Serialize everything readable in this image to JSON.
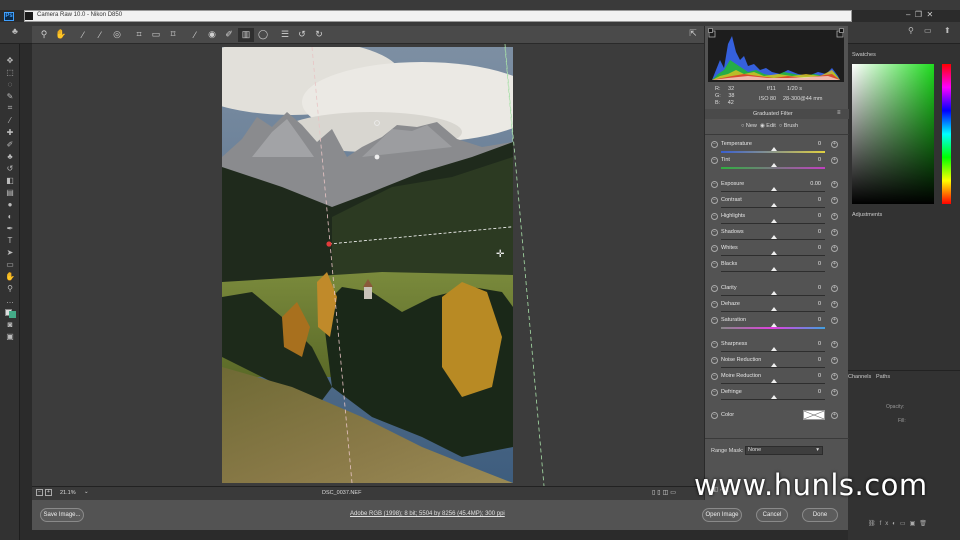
{
  "dialog": {
    "title": "Camera Raw 10.0  -  Nikon D850",
    "filename": "DSC_0037.NEF",
    "zoom": "21.1%",
    "workflow": "Adobe RGB (1998); 8 bit; 5504 by 8256 (45.4MP); 300 ppi"
  },
  "buttons": {
    "save": "Save Image...",
    "open": "Open Image",
    "cancel": "Cancel",
    "done": "Done"
  },
  "readout": {
    "r_label": "R:",
    "r_value": "32",
    "g_label": "G:",
    "g_value": "38",
    "b_label": "B:",
    "b_value": "42",
    "aperture": "f/11",
    "shutter": "1/20 s",
    "iso": "ISO 80",
    "lens": "28-300@44 mm"
  },
  "filter": {
    "title": "Graduated Filter",
    "modes": [
      "New",
      "Edit",
      "Brush"
    ],
    "selected_mode": "Edit"
  },
  "sliders_group1": [
    {
      "label": "Temperature",
      "value": "0"
    },
    {
      "label": "Tint",
      "value": "0"
    }
  ],
  "sliders_group2": [
    {
      "label": "Exposure",
      "value": "0.00"
    },
    {
      "label": "Contrast",
      "value": "0"
    },
    {
      "label": "Highlights",
      "value": "0"
    },
    {
      "label": "Shadows",
      "value": "0"
    },
    {
      "label": "Whites",
      "value": "0"
    },
    {
      "label": "Blacks",
      "value": "0"
    }
  ],
  "sliders_group3": [
    {
      "label": "Clarity",
      "value": "0"
    },
    {
      "label": "Dehaze",
      "value": "0"
    },
    {
      "label": "Saturation",
      "value": "0"
    }
  ],
  "sliders_group4": [
    {
      "label": "Sharpness",
      "value": "0"
    },
    {
      "label": "Noise Reduction",
      "value": "0"
    },
    {
      "label": "Moire Reduction",
      "value": "0"
    },
    {
      "label": "Defringe",
      "value": "0"
    }
  ],
  "color_label": "Color",
  "range_mask": {
    "label": "Range Mask:",
    "value": "None"
  },
  "ps_panels": {
    "swatches": "Swatches",
    "adjustments": "Adjustments",
    "channels": "Channels",
    "paths": "Paths",
    "opacity": "Opacity:",
    "fill": "Fill:"
  },
  "watermark": "www.hunls.com",
  "colors": {
    "dialog_bg": "#535353",
    "canvas_bg": "#3c3c3c",
    "guide_red": "#e23b3b",
    "guide_green": "#2ecc40"
  }
}
